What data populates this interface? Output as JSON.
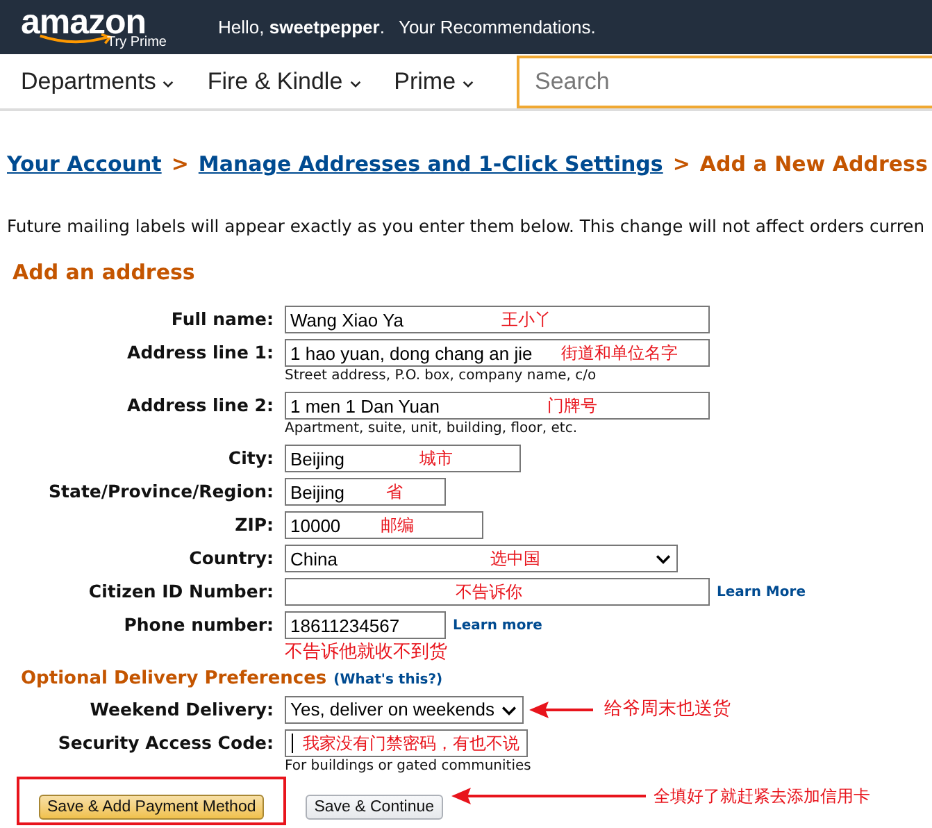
{
  "header": {
    "logo": "amazon",
    "logo_sub": "Try Prime",
    "greeting": "Hello, **sweetpepper**.",
    "recommendations": "Your Recommendations."
  },
  "nav": {
    "items": [
      "Departments",
      "Fire & Kindle",
      "Prime"
    ],
    "search": {
      "placeholder": "Search"
    }
  },
  "breadcrumb": [
    {
      "label": "Your Account",
      "kind": "link"
    },
    {
      "label": ">",
      "kind": "separator"
    },
    {
      "label": "Manage Addresses and 1-Click Settings",
      "kind": "link"
    },
    {
      "label": ">",
      "kind": "separator"
    },
    {
      "label": "Add a New Address",
      "kind": "current"
    }
  ],
  "notice": "Future mailing labels will appear exactly as you enter them below. This change will not affect orders curren",
  "section_title": "Add an address",
  "fields": [
    {
      "label": "Full name:",
      "kind": "text",
      "value": "Wang Xiao Ya",
      "annotation": "王小丫"
    },
    {
      "label": "Address line 1:",
      "kind": "text",
      "value": "1 hao yuan, dong chang an jie",
      "annotation": "街道和单位名字",
      "hint": "Street address, P.O. box, company name, c/o"
    },
    {
      "label": "Address line 2:",
      "kind": "text",
      "value": "1 men 1 Dan Yuan",
      "annotation": "门牌号",
      "hint": "Apartment, suite, unit, building, floor, etc."
    },
    {
      "label": "City:",
      "kind": "text",
      "value": "Beijing",
      "annotation": "城市"
    },
    {
      "label": "State/Province/Region:",
      "kind": "text",
      "value": "Beijing",
      "annotation": "省"
    },
    {
      "label": "ZIP:",
      "kind": "text",
      "value": "10000",
      "annotation": "邮编"
    },
    {
      "label": "Country:",
      "kind": "select",
      "value": "China",
      "annotation": "选中国"
    },
    {
      "label": "Citizen ID Number:",
      "kind": "text",
      "annotation": "不告诉你",
      "link": "Learn More"
    },
    {
      "label": "Phone number:",
      "kind": "text",
      "value": "18611234567",
      "link": "Learn more",
      "note": "不告诉他就收不到货"
    }
  ],
  "optional": {
    "title": "Optional Delivery Preferences",
    "help_link": "(What's this?)"
  },
  "preferences": [
    {
      "label": "Weekend Delivery:",
      "kind": "select",
      "value": "Yes, deliver on weekends",
      "callout": "给爷周末也送货"
    },
    {
      "label": "Security Access Code:",
      "kind": "text",
      "focused": true,
      "annotation": "我家没有门禁密码，有也不说",
      "hint": "For buildings or gated communities"
    }
  ],
  "buttons": [
    {
      "label": "Save & Add Payment Method",
      "kind": "primary",
      "highlighted": true
    },
    {
      "label": "Save & Continue",
      "kind": "secondary",
      "highlighted": false
    }
  ],
  "button_callout": "全填好了就赶紧去添加信用卡"
}
